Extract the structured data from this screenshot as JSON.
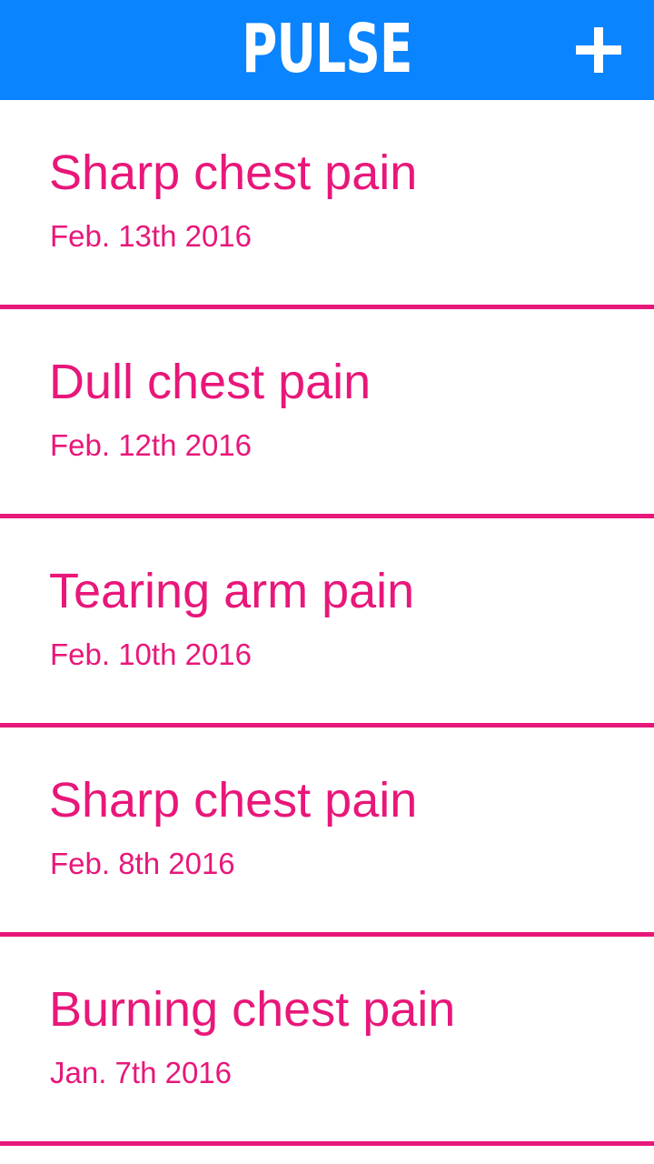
{
  "header": {
    "title": "PULSE",
    "add_icon": "plus-icon",
    "background_color": "#0a84ff"
  },
  "accent_color": "#e8177a",
  "entries": [
    {
      "title": "Sharp chest pain",
      "date": "Feb. 13th 2016"
    },
    {
      "title": "Dull chest pain",
      "date": "Feb. 12th 2016"
    },
    {
      "title": "Tearing arm pain",
      "date": "Feb. 10th 2016"
    },
    {
      "title": "Sharp chest pain",
      "date": "Feb. 8th 2016"
    },
    {
      "title": "Burning chest pain",
      "date": "Jan. 7th 2016"
    }
  ]
}
